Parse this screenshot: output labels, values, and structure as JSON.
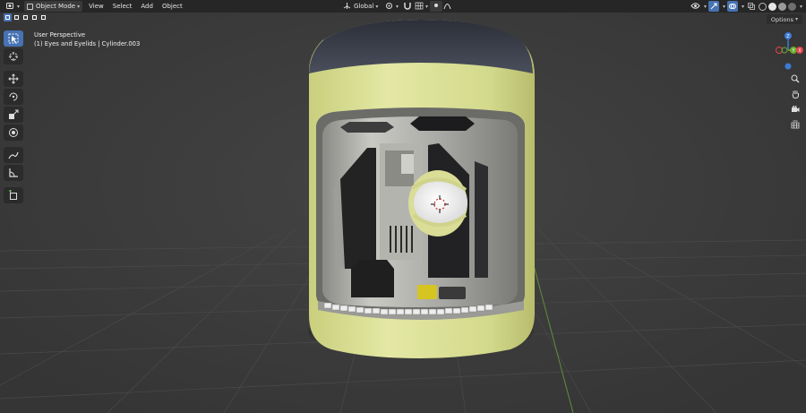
{
  "header": {
    "mode_label": "Object Mode",
    "menus": [
      "View",
      "Select",
      "Add",
      "Object"
    ],
    "orientation_label": "Global"
  },
  "viewport": {
    "perspective_label": "User Perspective",
    "object_label": "(1) Eyes and Eyelids | Cylinder.003",
    "options_label": "Options"
  },
  "gizmo": {
    "axes": [
      "Z",
      "Y",
      "X"
    ],
    "colors": {
      "x": "#e0444e",
      "y": "#6bab2f",
      "z": "#3b7bd6"
    }
  },
  "toolbar": {
    "tools": [
      "select-box-tool",
      "cursor-tool",
      "move-tool",
      "rotate-tool",
      "scale-tool",
      "transform-tool",
      "annotate-tool",
      "measure-tool",
      "add-cube-tool"
    ],
    "active_tool": "select-box-tool"
  },
  "navigation": {
    "buttons": [
      "zoom-icon",
      "hand-pan-icon",
      "camera-icon",
      "grid-view-icon"
    ]
  },
  "colors": {
    "accent": "#4772b3",
    "background": "#3d3d3d",
    "header": "#262626",
    "capsule_shell": "#d4da8c"
  }
}
